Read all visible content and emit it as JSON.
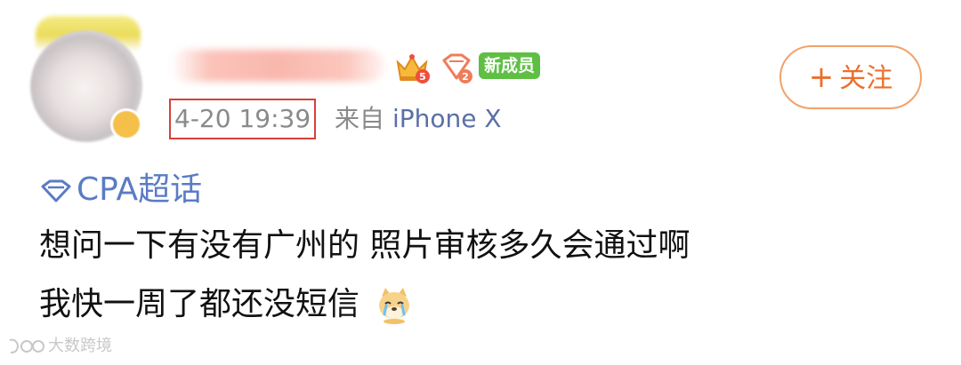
{
  "post": {
    "user": {
      "name": "",
      "member_badge": "新成员",
      "badges": [
        "crown-level-5-icon",
        "diamond-level-2-icon"
      ]
    },
    "follow_label": "关注",
    "follow_icon": "plus-icon",
    "timestamp": "4-20 19:39",
    "source": "来自",
    "device": "iPhone X",
    "topic": "CPA超话",
    "content_line1": "想问一下有没有广州的 照片审核多久会通过啊",
    "content_line2": "我快一周了都还没短信",
    "emoji": "crying-dog-emoji"
  },
  "watermark": "大数跨境",
  "colors": {
    "accent_orange": "#ec6f2c",
    "link_blue": "#5b7cc4",
    "highlight_red": "#d6403b",
    "member_green": "#5fbf45"
  }
}
